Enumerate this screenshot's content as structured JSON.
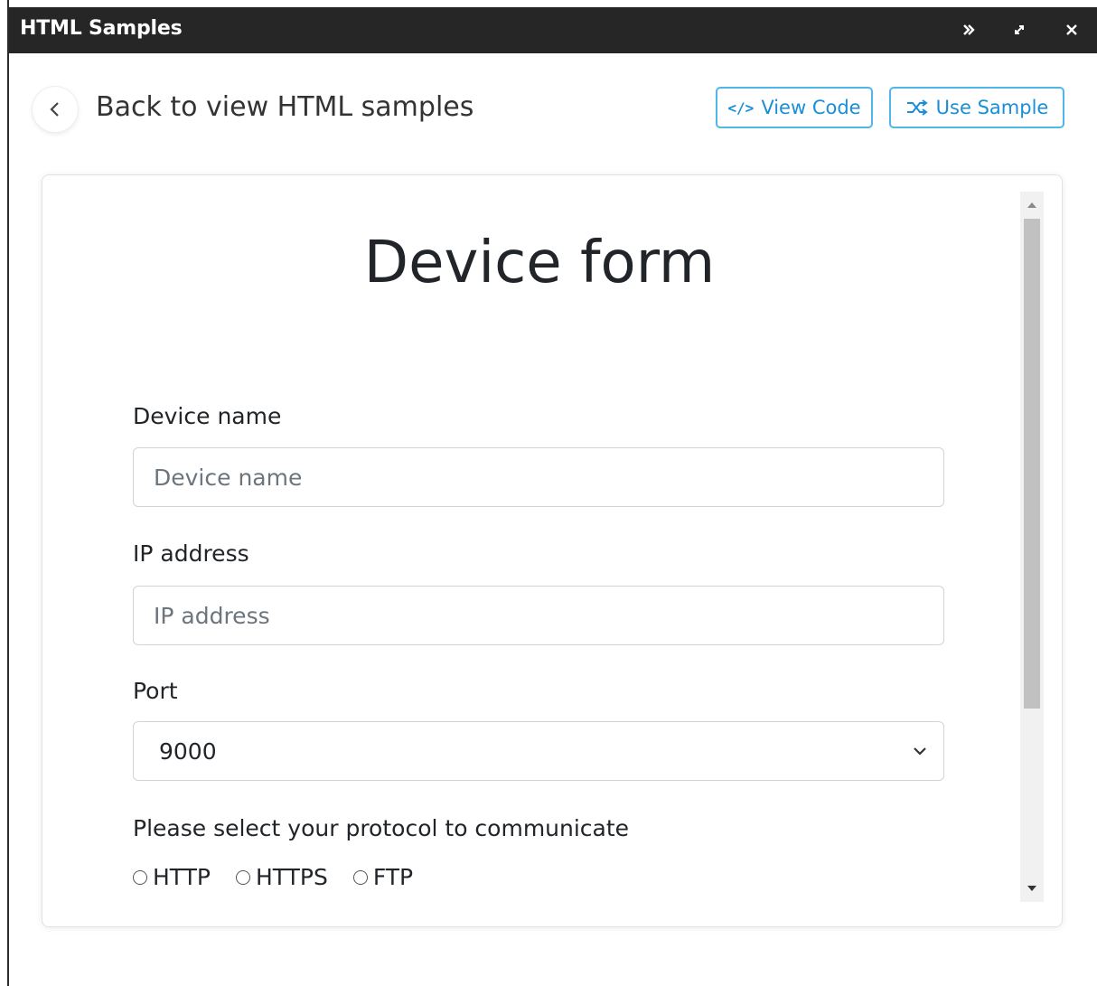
{
  "window": {
    "title": "HTML Samples"
  },
  "header": {
    "back_label": "Back to view HTML samples",
    "view_code_icon": "</>",
    "view_code_label": "View Code",
    "use_sample_label": "Use Sample"
  },
  "form": {
    "title": "Device form",
    "device_name": {
      "label": "Device name",
      "placeholder": "Device name",
      "value": ""
    },
    "ip_address": {
      "label": "IP address",
      "placeholder": "IP address",
      "value": ""
    },
    "port": {
      "label": "Port",
      "selected": "9000"
    },
    "protocol": {
      "label": "Please select your protocol to communicate",
      "options": [
        "HTTP",
        "HTTPS",
        "FTP"
      ]
    }
  },
  "colors": {
    "titlebar_bg": "#262626",
    "accent_border": "#4fb6ea",
    "accent_text": "#1a8ed6"
  },
  "icons": {
    "titlebar": [
      "double-chevron-right-icon",
      "expand-icon",
      "close-icon"
    ],
    "back": "chevron-left-icon",
    "view_code": "code-icon",
    "use_sample": "shuffle-icon",
    "select": "chevron-down-icon"
  }
}
